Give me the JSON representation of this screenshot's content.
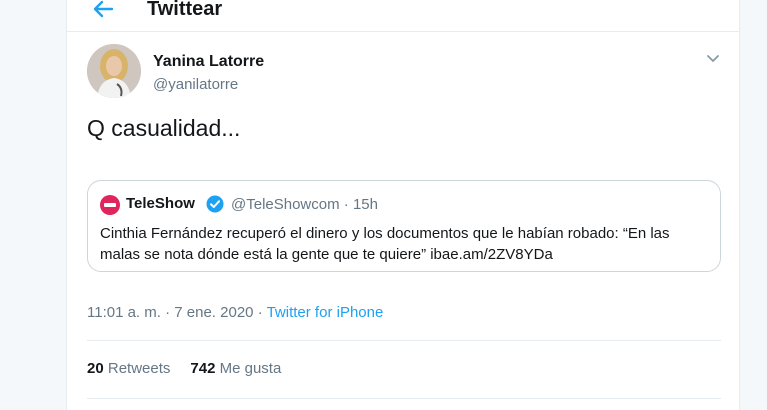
{
  "header": {
    "title": "Twittear",
    "back_icon": "arrow-left-icon"
  },
  "colors": {
    "accent": "#1da1f2",
    "text": "#14171a",
    "muted": "#657786",
    "border": "#e6ecf0",
    "brand_red": "#e0245e"
  },
  "tweet": {
    "author_name": "Yanina Latorre",
    "author_handle": "@yanilatorre",
    "text": "Q casualidad...",
    "quote": {
      "logo_icon": "teleshow-logo-icon",
      "name": "TeleShow",
      "handle": "@TeleShowcom",
      "separator": "·",
      "time": "15h",
      "text": "Cinthia Fernández recuperó el dinero y los documentos que le habían robado: “En las malas se nota dónde está la gente que te quiere” ibae.am/2ZV8YDa"
    },
    "time": "11:01 a. m. · 7 ene. 2020",
    "meta_separator": "·",
    "source": "Twitter for iPhone",
    "retweets_count": "20",
    "retweets_label": "Retweets",
    "likes_count": "742",
    "likes_label": "Me gusta"
  }
}
